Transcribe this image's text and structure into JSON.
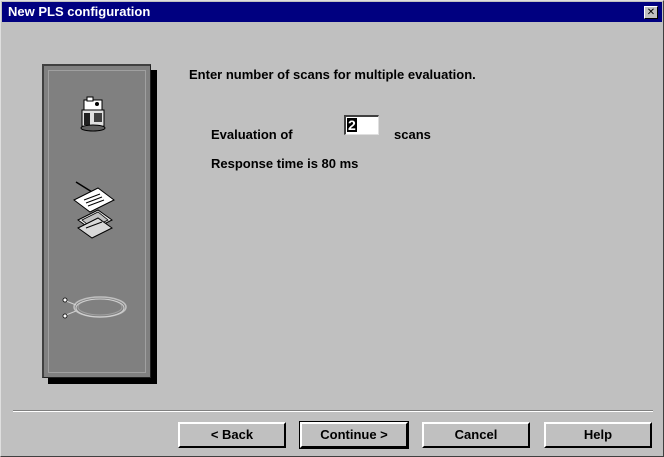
{
  "window": {
    "title": "New PLS configuration",
    "close_glyph": "✕"
  },
  "side_panel": {
    "icons": [
      "scanner-device-icon",
      "documents-stack-icon",
      "cable-coil-icon"
    ]
  },
  "content": {
    "instruction": "Enter number of scans for multiple evaluation.",
    "evaluation_label": "Evaluation of",
    "scan_count": "2",
    "scans_label": "scans",
    "response_time": "Response time is 80 ms"
  },
  "buttons": {
    "back": "< Back",
    "continue": "Continue >",
    "cancel": "Cancel",
    "help": "Help"
  },
  "colors": {
    "titlebar": "#000080",
    "dialog_bg": "#c0c0c0",
    "panel_bg": "#808080"
  }
}
